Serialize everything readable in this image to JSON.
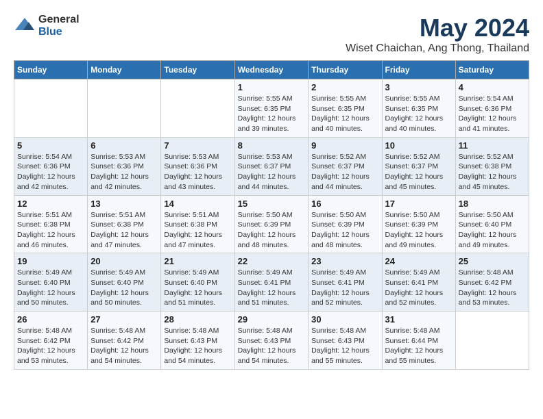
{
  "header": {
    "logo_line1": "General",
    "logo_line2": "Blue",
    "main_title": "May 2024",
    "subtitle": "Wiset Chaichan, Ang Thong, Thailand"
  },
  "days_of_week": [
    "Sunday",
    "Monday",
    "Tuesday",
    "Wednesday",
    "Thursday",
    "Friday",
    "Saturday"
  ],
  "weeks": [
    {
      "cells": [
        {
          "day": "",
          "info": ""
        },
        {
          "day": "",
          "info": ""
        },
        {
          "day": "",
          "info": ""
        },
        {
          "day": "1",
          "info": "Sunrise: 5:55 AM\nSunset: 6:35 PM\nDaylight: 12 hours\nand 39 minutes."
        },
        {
          "day": "2",
          "info": "Sunrise: 5:55 AM\nSunset: 6:35 PM\nDaylight: 12 hours\nand 40 minutes."
        },
        {
          "day": "3",
          "info": "Sunrise: 5:55 AM\nSunset: 6:35 PM\nDaylight: 12 hours\nand 40 minutes."
        },
        {
          "day": "4",
          "info": "Sunrise: 5:54 AM\nSunset: 6:36 PM\nDaylight: 12 hours\nand 41 minutes."
        }
      ]
    },
    {
      "cells": [
        {
          "day": "5",
          "info": "Sunrise: 5:54 AM\nSunset: 6:36 PM\nDaylight: 12 hours\nand 42 minutes."
        },
        {
          "day": "6",
          "info": "Sunrise: 5:53 AM\nSunset: 6:36 PM\nDaylight: 12 hours\nand 42 minutes."
        },
        {
          "day": "7",
          "info": "Sunrise: 5:53 AM\nSunset: 6:36 PM\nDaylight: 12 hours\nand 43 minutes."
        },
        {
          "day": "8",
          "info": "Sunrise: 5:53 AM\nSunset: 6:37 PM\nDaylight: 12 hours\nand 44 minutes."
        },
        {
          "day": "9",
          "info": "Sunrise: 5:52 AM\nSunset: 6:37 PM\nDaylight: 12 hours\nand 44 minutes."
        },
        {
          "day": "10",
          "info": "Sunrise: 5:52 AM\nSunset: 6:37 PM\nDaylight: 12 hours\nand 45 minutes."
        },
        {
          "day": "11",
          "info": "Sunrise: 5:52 AM\nSunset: 6:38 PM\nDaylight: 12 hours\nand 45 minutes."
        }
      ]
    },
    {
      "cells": [
        {
          "day": "12",
          "info": "Sunrise: 5:51 AM\nSunset: 6:38 PM\nDaylight: 12 hours\nand 46 minutes."
        },
        {
          "day": "13",
          "info": "Sunrise: 5:51 AM\nSunset: 6:38 PM\nDaylight: 12 hours\nand 47 minutes."
        },
        {
          "day": "14",
          "info": "Sunrise: 5:51 AM\nSunset: 6:38 PM\nDaylight: 12 hours\nand 47 minutes."
        },
        {
          "day": "15",
          "info": "Sunrise: 5:50 AM\nSunset: 6:39 PM\nDaylight: 12 hours\nand 48 minutes."
        },
        {
          "day": "16",
          "info": "Sunrise: 5:50 AM\nSunset: 6:39 PM\nDaylight: 12 hours\nand 48 minutes."
        },
        {
          "day": "17",
          "info": "Sunrise: 5:50 AM\nSunset: 6:39 PM\nDaylight: 12 hours\nand 49 minutes."
        },
        {
          "day": "18",
          "info": "Sunrise: 5:50 AM\nSunset: 6:40 PM\nDaylight: 12 hours\nand 49 minutes."
        }
      ]
    },
    {
      "cells": [
        {
          "day": "19",
          "info": "Sunrise: 5:49 AM\nSunset: 6:40 PM\nDaylight: 12 hours\nand 50 minutes."
        },
        {
          "day": "20",
          "info": "Sunrise: 5:49 AM\nSunset: 6:40 PM\nDaylight: 12 hours\nand 50 minutes."
        },
        {
          "day": "21",
          "info": "Sunrise: 5:49 AM\nSunset: 6:40 PM\nDaylight: 12 hours\nand 51 minutes."
        },
        {
          "day": "22",
          "info": "Sunrise: 5:49 AM\nSunset: 6:41 PM\nDaylight: 12 hours\nand 51 minutes."
        },
        {
          "day": "23",
          "info": "Sunrise: 5:49 AM\nSunset: 6:41 PM\nDaylight: 12 hours\nand 52 minutes."
        },
        {
          "day": "24",
          "info": "Sunrise: 5:49 AM\nSunset: 6:41 PM\nDaylight: 12 hours\nand 52 minutes."
        },
        {
          "day": "25",
          "info": "Sunrise: 5:48 AM\nSunset: 6:42 PM\nDaylight: 12 hours\nand 53 minutes."
        }
      ]
    },
    {
      "cells": [
        {
          "day": "26",
          "info": "Sunrise: 5:48 AM\nSunset: 6:42 PM\nDaylight: 12 hours\nand 53 minutes."
        },
        {
          "day": "27",
          "info": "Sunrise: 5:48 AM\nSunset: 6:42 PM\nDaylight: 12 hours\nand 54 minutes."
        },
        {
          "day": "28",
          "info": "Sunrise: 5:48 AM\nSunset: 6:43 PM\nDaylight: 12 hours\nand 54 minutes."
        },
        {
          "day": "29",
          "info": "Sunrise: 5:48 AM\nSunset: 6:43 PM\nDaylight: 12 hours\nand 54 minutes."
        },
        {
          "day": "30",
          "info": "Sunrise: 5:48 AM\nSunset: 6:43 PM\nDaylight: 12 hours\nand 55 minutes."
        },
        {
          "day": "31",
          "info": "Sunrise: 5:48 AM\nSunset: 6:44 PM\nDaylight: 12 hours\nand 55 minutes."
        },
        {
          "day": "",
          "info": ""
        }
      ]
    }
  ]
}
